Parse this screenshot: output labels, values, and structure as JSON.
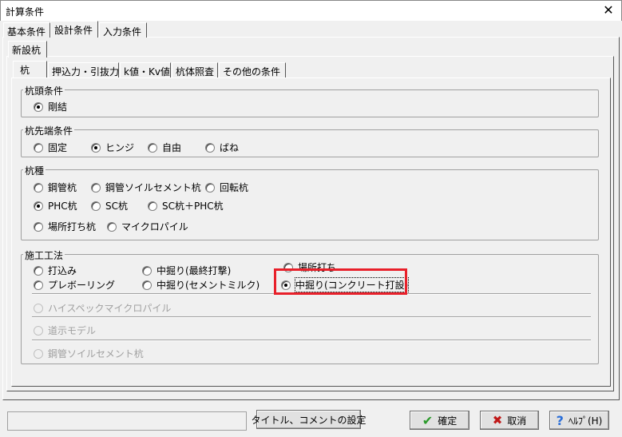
{
  "window": {
    "title": "計算条件",
    "close": "✕"
  },
  "top_tabs": [
    {
      "label": "基本条件"
    },
    {
      "label": "設計条件",
      "selected": true
    },
    {
      "label": "入力条件"
    }
  ],
  "sub_tab": {
    "label": "新設杭"
  },
  "inner_tabs": [
    {
      "label": "杭",
      "selected": true
    },
    {
      "label": "押込力・引抜力"
    },
    {
      "label": "k値・Kv値"
    },
    {
      "label": "杭体照査"
    },
    {
      "label": "その他の条件"
    }
  ],
  "groups": {
    "head": {
      "label": "杭頭条件",
      "options": [
        {
          "label": "剛結",
          "checked": true
        }
      ]
    },
    "tip": {
      "label": "杭先端条件",
      "options": [
        {
          "label": "固定"
        },
        {
          "label": "ヒンジ",
          "checked": true
        },
        {
          "label": "自由"
        },
        {
          "label": "ばね"
        }
      ]
    },
    "type": {
      "label": "杭種",
      "options": [
        {
          "label": "鋼管杭"
        },
        {
          "label": "鋼管ソイルセメント杭"
        },
        {
          "label": "回転杭"
        },
        {
          "label": "PHC杭",
          "checked": true
        },
        {
          "label": "SC杭"
        },
        {
          "label": "SC杭＋PHC杭"
        },
        {
          "label": "場所打ち杭"
        },
        {
          "label": "マイクロパイル"
        }
      ]
    },
    "method": {
      "label": "施工工法",
      "options": [
        {
          "label": "打込み"
        },
        {
          "label": "中掘り(最終打撃)"
        },
        {
          "label": "場所打ち"
        },
        {
          "label": "プレボーリング"
        },
        {
          "label": "中掘り(セメントミルク)"
        },
        {
          "label": "中掘り(コンクリート打設)",
          "checked": true,
          "focused": true
        },
        {
          "label": "ハイスペックマイクロパイル",
          "disabled": true
        },
        {
          "label": "道示モデル",
          "disabled": true
        },
        {
          "label": "鋼管ソイルセメント杭",
          "disabled": true
        }
      ]
    }
  },
  "footer": {
    "status": "",
    "title_button": "タイトル、コメントの設定",
    "ok": "確定",
    "cancel": "取消",
    "help": "ﾍﾙﾌﾟ(H)",
    "ok_icon": "✔",
    "cancel_icon": "✖",
    "help_icon": "?",
    "colors": {
      "highlight": "#e8202a",
      "ok": "#2a9a2a",
      "cancel": "#c01818",
      "help": "#2a6ed8"
    }
  }
}
